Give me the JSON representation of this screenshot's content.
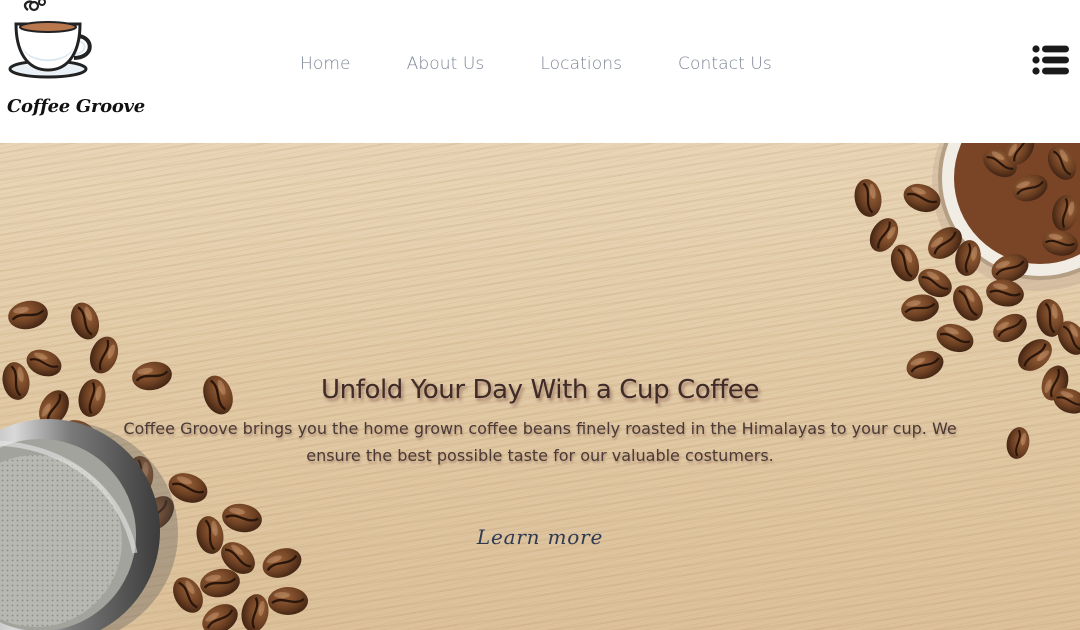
{
  "brand": {
    "name": "Coffee Groove"
  },
  "nav": {
    "items": [
      {
        "label": "Home"
      },
      {
        "label": "About Us"
      },
      {
        "label": "Locations"
      },
      {
        "label": "Contact Us"
      }
    ],
    "menu_icon": "hamburger-menu-icon"
  },
  "hero": {
    "heading": "Unfold Your Day With a Cup Coffee",
    "paragraph": "Coffee Groove brings you the home grown coffee beans finely roasted in the Himalayas to your cup. We ensure the best possible taste for our valuable costumers.",
    "cta_label": "Learn more"
  },
  "colors": {
    "nav_text": "#7d8595",
    "heading_text": "#3f2b27",
    "cta_text": "#2e3a52",
    "wood_background": "#e2cba7",
    "coffee_bean": "#6b3f22"
  }
}
